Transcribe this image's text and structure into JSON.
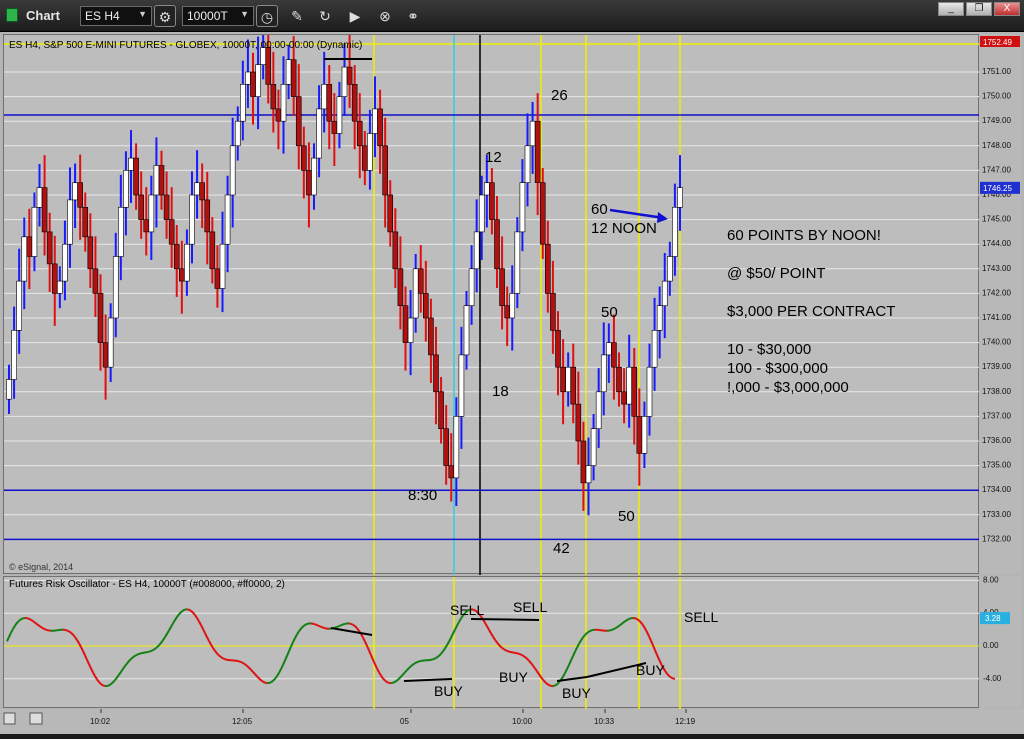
{
  "window": {
    "title": "Chart",
    "symbol": "ES H4",
    "interval": "10000T",
    "minimize": "_",
    "restore": "❐",
    "close": "X"
  },
  "chart": {
    "title": "ES H4, S&P 500 E-MINI FUTURES - GLOBEX, 10000T, 00:00-00:00 (Dynamic)",
    "copyright": "© eSignal, 2014",
    "price_ticks": [
      "1751.00",
      "1750.00",
      "1749.00",
      "1748.00",
      "1747.00",
      "1746.00",
      "1745.00",
      "1744.00",
      "1743.00",
      "1742.00",
      "1741.00",
      "1740.00",
      "1739.00",
      "1738.00",
      "1737.00",
      "1736.00",
      "1735.00",
      "1734.00",
      "1733.00",
      "1732.00"
    ],
    "high_tag": "1752.49",
    "last_tag": "1746.25",
    "time_ticks": [
      "10:02",
      "12:05",
      "05",
      "10:00",
      "10:33",
      "12:19"
    ],
    "colors": {
      "up": "#1a1aff",
      "down": "#e01010",
      "level_line": "#1010c8",
      "time_line": "#f0f000",
      "cyan_line": "#30d0e0",
      "cursor_line": "#000000"
    }
  },
  "chart_data": {
    "type": "candlestick",
    "price_range": [
      1731.2,
      1752.8
    ],
    "horizontal_levels": [
      1749.25,
      1734.0,
      1732.0
    ],
    "annotations": [
      "26",
      "12",
      "18",
      "8:30",
      "42",
      "50",
      "50",
      "60",
      "12 NOON"
    ]
  },
  "notes": {
    "line1": "60 POINTS BY NOON!",
    "line2": "@ $50/ POINT",
    "line3": "$3,000 PER CONTRACT",
    "line4": "10 - $30,000",
    "line5": "100 - $300,000",
    "line6": "!,000 - $3,000,000"
  },
  "oscillator": {
    "title": "Futures Risk Oscillator - ES H4, 10000T (#008000, #ff0000, 2)",
    "ticks": [
      "8.00",
      "4.00",
      "0.00",
      "-4.00"
    ],
    "value_tag": "3.28",
    "labels": {
      "sell1": "SELL",
      "sell2": "SELL",
      "sell3": "SELL",
      "buy1": "BUY",
      "buy2": "BUY",
      "buy3": "BUY",
      "buy4": "BUY"
    }
  }
}
